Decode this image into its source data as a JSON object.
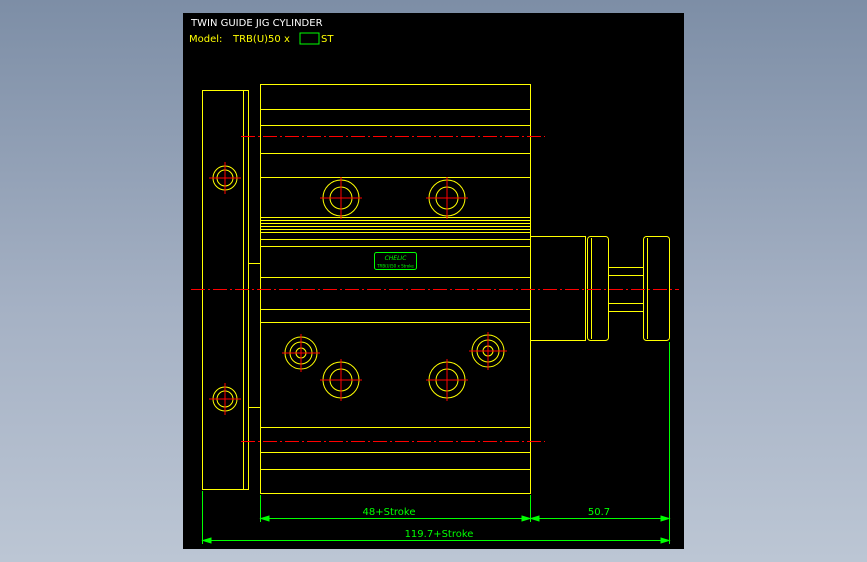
{
  "drawing": {
    "title": "TWIN GUIDE JIG CYLINDER",
    "model_label": "Model:",
    "model_code": "TRB(U)50 x",
    "model_suffix": "ST",
    "logo_top": "CHELIC",
    "logo_bottom": "TRB(U)50 x Stroke"
  },
  "dimensions": {
    "body_length": "48+Stroke",
    "rod_extension": "50.7",
    "overall_length": "119.7+Stroke"
  },
  "colors": {
    "background": "#000000",
    "outline": "#ffff00",
    "centerline": "#ff0000",
    "dimension": "#00ff00",
    "title_text": "#ffffff",
    "model_text": "#ffff00"
  }
}
